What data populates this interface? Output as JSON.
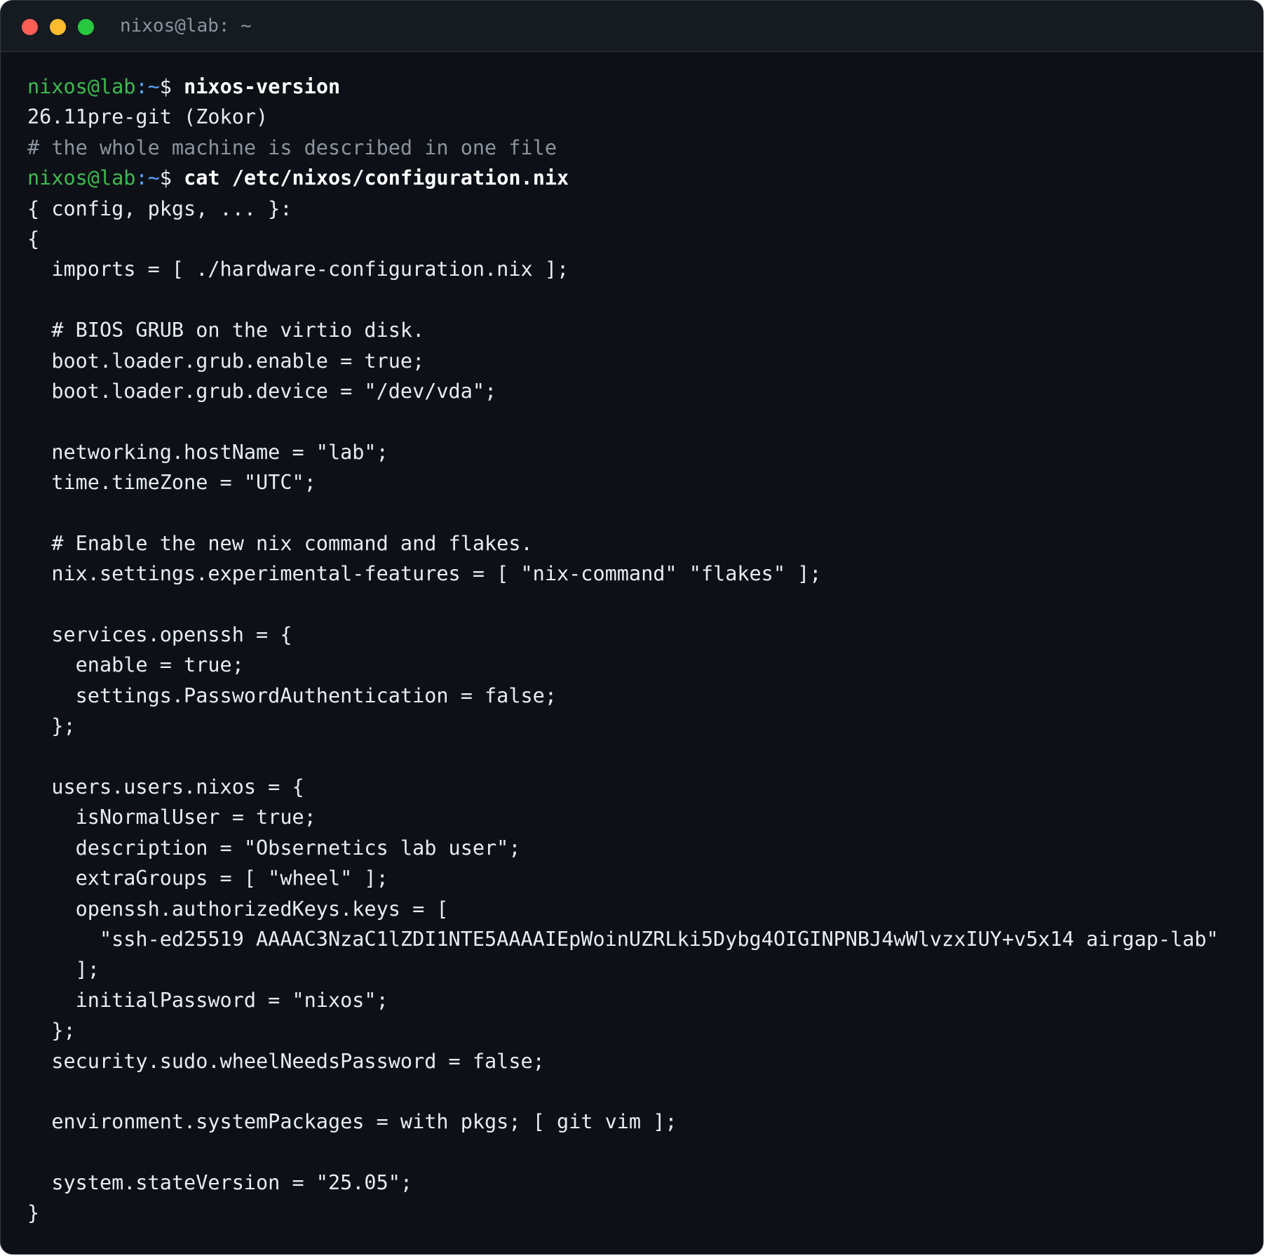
{
  "window": {
    "title": "nixos@lab: ~",
    "buttons": [
      {
        "name": "close",
        "color": "#ff5f57"
      },
      {
        "name": "minimize",
        "color": "#febc2e"
      },
      {
        "name": "maximize",
        "color": "#28c840"
      }
    ]
  },
  "colors": {
    "background": "#0d1117",
    "titlebar": "#161b22",
    "prompt_user": "#3fb950",
    "prompt_path": "#58a6ff",
    "text": "#e6edf3",
    "comment": "#8b949e"
  },
  "terminal": {
    "lines": [
      {
        "type": "prompt",
        "user": "nixos@lab",
        "path": ":~",
        "sign": "$ ",
        "command": "nixos-version"
      },
      {
        "type": "output",
        "text": "26.11pre-git (Zokor)"
      },
      {
        "type": "comment",
        "text": "# the whole machine is described in one file"
      },
      {
        "type": "prompt",
        "user": "nixos@lab",
        "path": ":~",
        "sign": "$ ",
        "command": "cat /etc/nixos/configuration.nix"
      },
      {
        "type": "output",
        "text": "{ config, pkgs, ... }:"
      },
      {
        "type": "output",
        "text": "{"
      },
      {
        "type": "output",
        "text": "  imports = [ ./hardware-configuration.nix ];"
      },
      {
        "type": "output",
        "text": ""
      },
      {
        "type": "output",
        "text": "  # BIOS GRUB on the virtio disk."
      },
      {
        "type": "output",
        "text": "  boot.loader.grub.enable = true;"
      },
      {
        "type": "output",
        "text": "  boot.loader.grub.device = \"/dev/vda\";"
      },
      {
        "type": "output",
        "text": ""
      },
      {
        "type": "output",
        "text": "  networking.hostName = \"lab\";"
      },
      {
        "type": "output",
        "text": "  time.timeZone = \"UTC\";"
      },
      {
        "type": "output",
        "text": ""
      },
      {
        "type": "output",
        "text": "  # Enable the new nix command and flakes."
      },
      {
        "type": "output",
        "text": "  nix.settings.experimental-features = [ \"nix-command\" \"flakes\" ];"
      },
      {
        "type": "output",
        "text": ""
      },
      {
        "type": "output",
        "text": "  services.openssh = {"
      },
      {
        "type": "output",
        "text": "    enable = true;"
      },
      {
        "type": "output",
        "text": "    settings.PasswordAuthentication = false;"
      },
      {
        "type": "output",
        "text": "  };"
      },
      {
        "type": "output",
        "text": ""
      },
      {
        "type": "output",
        "text": "  users.users.nixos = {"
      },
      {
        "type": "output",
        "text": "    isNormalUser = true;"
      },
      {
        "type": "output",
        "text": "    description = \"Obsernetics lab user\";"
      },
      {
        "type": "output",
        "text": "    extraGroups = [ \"wheel\" ];"
      },
      {
        "type": "output",
        "text": "    openssh.authorizedKeys.keys = ["
      },
      {
        "type": "output",
        "text": "      \"ssh-ed25519 AAAAC3NzaC1lZDI1NTE5AAAAIEpWoinUZRLki5Dybg4OIGINPNBJ4wWlvzxIUY+v5x14 airgap-lab\""
      },
      {
        "type": "output",
        "text": "    ];"
      },
      {
        "type": "output",
        "text": "    initialPassword = \"nixos\";"
      },
      {
        "type": "output",
        "text": "  };"
      },
      {
        "type": "output",
        "text": "  security.sudo.wheelNeedsPassword = false;"
      },
      {
        "type": "output",
        "text": ""
      },
      {
        "type": "output",
        "text": "  environment.systemPackages = with pkgs; [ git vim ];"
      },
      {
        "type": "output",
        "text": ""
      },
      {
        "type": "output",
        "text": "  system.stateVersion = \"25.05\";"
      },
      {
        "type": "output",
        "text": "}"
      }
    ]
  }
}
